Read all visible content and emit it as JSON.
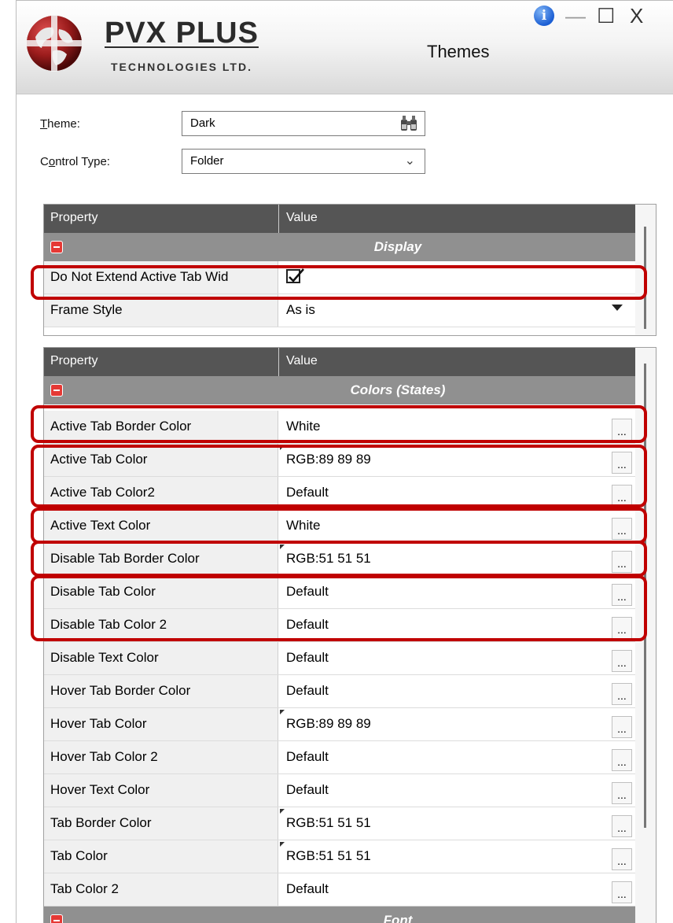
{
  "window": {
    "title": "Themes",
    "brand_name": "PVX PLUS",
    "brand_sub": "TECHNOLOGIES LTD.",
    "info_glyph": "i",
    "minimize_glyph": "—",
    "maximize_glyph": "☐",
    "close_glyph": "X"
  },
  "form": {
    "theme_label_u": "T",
    "theme_label_rest": "heme:",
    "theme_value": "Dark",
    "control_label_a": "C",
    "control_label_u": "o",
    "control_label_rest": "ntrol Type:",
    "control_value": "Folder"
  },
  "grid1": {
    "col_property": "Property",
    "col_value": "Value",
    "group": "Display",
    "rows": [
      {
        "name": "Do Not Extend Active Tab Wid",
        "value": "",
        "checked": true
      },
      {
        "name": "Frame Style",
        "value": "As is"
      }
    ]
  },
  "grid2": {
    "col_property": "Property",
    "col_value": "Value",
    "group": "Colors (States)",
    "ellipsis": "...",
    "rows": [
      {
        "name": "Active Tab Border Color",
        "value": "White"
      },
      {
        "name": "Active Tab Color",
        "value": "RGB:89 89 89"
      },
      {
        "name": "Active Tab Color2",
        "value": "Default"
      },
      {
        "name": "Active Text Color",
        "value": "White"
      },
      {
        "name": "Disable Tab Border Color",
        "value": "RGB:51 51 51"
      },
      {
        "name": "Disable Tab Color",
        "value": "Default"
      },
      {
        "name": "Disable Tab Color 2",
        "value": "Default"
      },
      {
        "name": "Disable Text Color",
        "value": "Default"
      },
      {
        "name": "Hover Tab Border Color",
        "value": "Default"
      },
      {
        "name": "Hover Tab Color",
        "value": "RGB:89 89 89"
      },
      {
        "name": "Hover Tab Color 2",
        "value": "Default"
      },
      {
        "name": "Hover Text Color",
        "value": "Default"
      },
      {
        "name": "Tab Border Color",
        "value": "RGB:51 51 51"
      },
      {
        "name": "Tab Color",
        "value": "RGB:51 51 51"
      },
      {
        "name": "Tab Color 2",
        "value": "Default"
      }
    ],
    "next_group": "Font"
  },
  "colors": {
    "header_dark": "#555555",
    "group_gray": "#909090",
    "highlight_red": "#c00000"
  }
}
